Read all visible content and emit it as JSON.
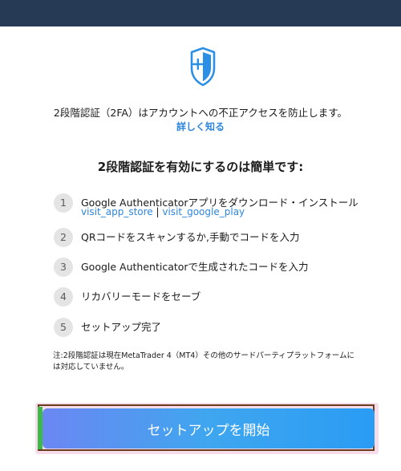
{
  "intro": {
    "description": "2段階認証（2FA）はアカウントへの不正アクセスを防止します。",
    "learn_more": "詳しく知る"
  },
  "heading": "2段階認証を有効にするのは簡単です:",
  "steps": [
    {
      "number": "1",
      "text": "Google Authenticatorアプリをダウンロード・インストール"
    },
    {
      "number": "2",
      "text": "QRコードをスキャンするか,手動でコードを入力"
    },
    {
      "number": "3",
      "text": "Google Authenticatorで生成されたコードを入力"
    },
    {
      "number": "4",
      "text": "リカバリーモードをセーブ"
    },
    {
      "number": "5",
      "text": "セットアップ完了"
    }
  ],
  "store_links": {
    "app_store": "visit_app_store",
    "separator": "|",
    "google_play": "visit_google_play"
  },
  "note": "注:2段階認証は現在MetaTrader 4（MT4）その他のサードパーティプラットフォームには対応していません。",
  "cta": {
    "label": "セットアップを開始"
  },
  "icons": {
    "shield": "shield-plus-icon"
  },
  "colors": {
    "header": "#263a55",
    "link": "#2e86de",
    "shield": "#2b8fe6",
    "button": "#2a9cf4"
  }
}
